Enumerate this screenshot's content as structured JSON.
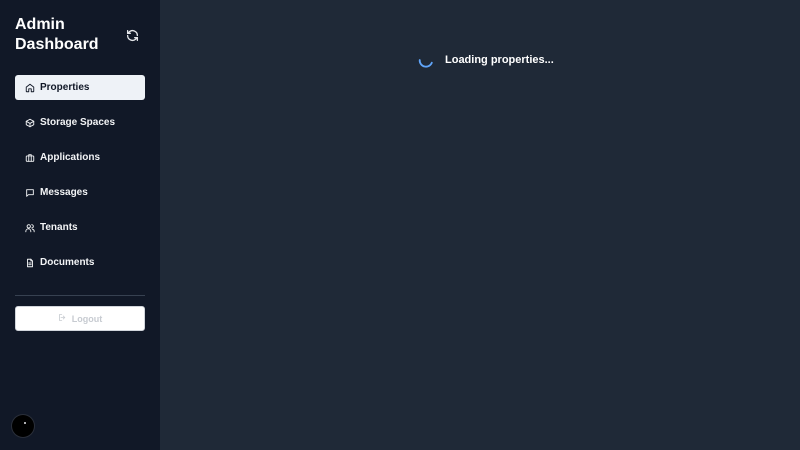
{
  "sidebar": {
    "title": "Admin Dashboard",
    "refresh_icon": "refresh-icon",
    "items": [
      {
        "label": "Properties",
        "icon": "home-icon",
        "active": true
      },
      {
        "label": "Storage Spaces",
        "icon": "box-icon",
        "active": false
      },
      {
        "label": "Applications",
        "icon": "briefcase-icon",
        "active": false
      },
      {
        "label": "Messages",
        "icon": "message-icon",
        "active": false
      },
      {
        "label": "Tenants",
        "icon": "users-icon",
        "active": false
      },
      {
        "label": "Documents",
        "icon": "file-icon",
        "active": false
      }
    ],
    "logout_label": "Logout"
  },
  "main": {
    "loading_text": "Loading properties..."
  },
  "colors": {
    "sidebar_bg": "#111827",
    "main_bg": "#1f2937",
    "active_item_bg": "#eef2f7",
    "spinner_accent": "#60a5fa"
  }
}
